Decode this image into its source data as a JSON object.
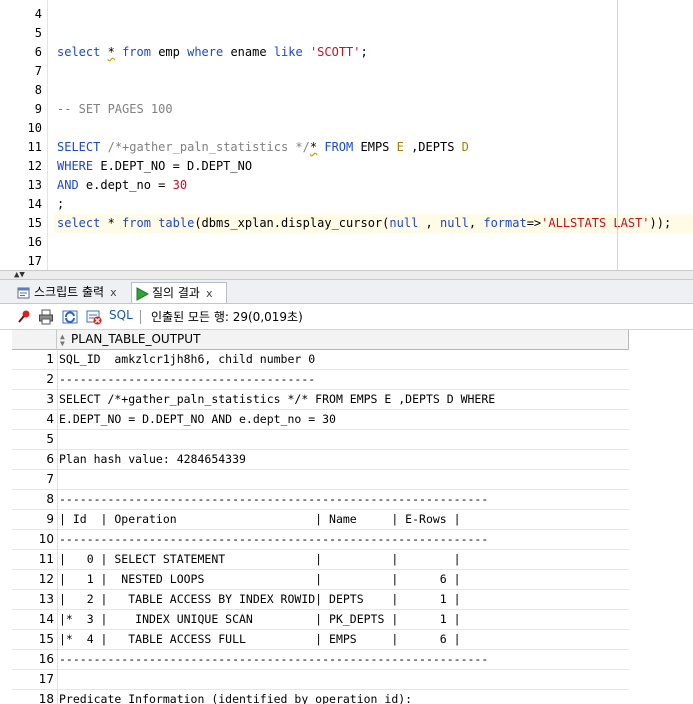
{
  "editor": {
    "lines": [
      {
        "n": "4",
        "tokens": []
      },
      {
        "n": "5",
        "tokens": []
      },
      {
        "n": "6",
        "tokens": [
          {
            "t": "select",
            "c": "kw"
          },
          {
            "t": " ",
            "c": "op"
          },
          {
            "t": "*",
            "c": "op",
            "warn": true
          },
          {
            "t": " ",
            "c": "op"
          },
          {
            "t": "from",
            "c": "kw"
          },
          {
            "t": " emp ",
            "c": "id"
          },
          {
            "t": "where",
            "c": "kw"
          },
          {
            "t": " ename ",
            "c": "id"
          },
          {
            "t": "like",
            "c": "kw"
          },
          {
            "t": " ",
            "c": "op"
          },
          {
            "t": "'SCOTT'",
            "c": "str"
          },
          {
            "t": ";",
            "c": "op"
          }
        ]
      },
      {
        "n": "7",
        "tokens": []
      },
      {
        "n": "8",
        "tokens": []
      },
      {
        "n": "9",
        "tokens": [
          {
            "t": "-- SET PAGES 100",
            "c": "cm"
          }
        ]
      },
      {
        "n": "10",
        "tokens": []
      },
      {
        "n": "11",
        "tokens": [
          {
            "t": "SELECT",
            "c": "kw"
          },
          {
            "t": " ",
            "c": "op"
          },
          {
            "t": "/*+gather_paln_statistics */",
            "c": "cm"
          },
          {
            "t": "*",
            "c": "op",
            "warn": true
          },
          {
            "t": " ",
            "c": "op"
          },
          {
            "t": "FROM",
            "c": "kw"
          },
          {
            "t": " EMPS ",
            "c": "id"
          },
          {
            "t": "E",
            "c": "tok-y"
          },
          {
            "t": " ,DEPTS ",
            "c": "id"
          },
          {
            "t": "D",
            "c": "tok-y"
          }
        ]
      },
      {
        "n": "12",
        "tokens": [
          {
            "t": "WHERE",
            "c": "kw"
          },
          {
            "t": " E.DEPT_NO = D.DEPT_NO",
            "c": "id"
          }
        ]
      },
      {
        "n": "13",
        "tokens": [
          {
            "t": "AND",
            "c": "kw"
          },
          {
            "t": " e.dept_no = ",
            "c": "id"
          },
          {
            "t": "30",
            "c": "str"
          }
        ]
      },
      {
        "n": "14",
        "tokens": [
          {
            "t": ";",
            "c": "op"
          }
        ]
      },
      {
        "n": "15",
        "tokens": [
          {
            "t": "select",
            "c": "kw"
          },
          {
            "t": " * ",
            "c": "op"
          },
          {
            "t": "from",
            "c": "kw"
          },
          {
            "t": " ",
            "c": "op"
          },
          {
            "t": "table",
            "c": "kw"
          },
          {
            "t": "(dbms_xplan.display_cursor(",
            "c": "id"
          },
          {
            "t": "null",
            "c": "kw"
          },
          {
            "t": " , ",
            "c": "op"
          },
          {
            "t": "null",
            "c": "kw"
          },
          {
            "t": ", ",
            "c": "op"
          },
          {
            "t": "format",
            "c": "kw"
          },
          {
            "t": "=>",
            "c": "op"
          },
          {
            "t": "'ALLSTATS LAST'",
            "c": "str"
          },
          {
            "t": "));",
            "c": "op"
          }
        ]
      },
      {
        "n": "16",
        "tokens": []
      },
      {
        "n": "17",
        "tokens": []
      }
    ]
  },
  "tabs": {
    "script_output": {
      "label": "스크립트 출력",
      "close": "x"
    },
    "query_result": {
      "label": "질의 결과",
      "close": "x"
    }
  },
  "toolbar": {
    "sql_label": "SQL",
    "separator": "|",
    "fetch_status": "인출된 모든 행: 29(0,019초)"
  },
  "grid": {
    "column": "PLAN_TABLE_OUTPUT",
    "rows": [
      {
        "n": "1",
        "v": "SQL_ID  amkzlcr1jh8h6, child number 0"
      },
      {
        "n": "2",
        "v": "-------------------------------------"
      },
      {
        "n": "3",
        "v": "SELECT /*+gather_paln_statistics */* FROM EMPS E ,DEPTS D WHERE"
      },
      {
        "n": "4",
        "v": "E.DEPT_NO = D.DEPT_NO AND e.dept_no = 30"
      },
      {
        "n": "5",
        "v": ""
      },
      {
        "n": "6",
        "v": "Plan hash value: 4284654339"
      },
      {
        "n": "7",
        "v": ""
      },
      {
        "n": "8",
        "v": "--------------------------------------------------------------"
      },
      {
        "n": "9",
        "v": "| Id  | Operation                    | Name     | E-Rows |"
      },
      {
        "n": "10",
        "v": "--------------------------------------------------------------"
      },
      {
        "n": "11",
        "v": "|   0 | SELECT STATEMENT             |          |        |"
      },
      {
        "n": "12",
        "v": "|   1 |  NESTED LOOPS                |          |      6 |"
      },
      {
        "n": "13",
        "v": "|   2 |   TABLE ACCESS BY INDEX ROWID| DEPTS    |      1 |"
      },
      {
        "n": "14",
        "v": "|*  3 |    INDEX UNIQUE SCAN         | PK_DEPTS |      1 |"
      },
      {
        "n": "15",
        "v": "|*  4 |   TABLE ACCESS FULL          | EMPS     |      6 |"
      },
      {
        "n": "16",
        "v": "--------------------------------------------------------------"
      },
      {
        "n": "17",
        "v": ""
      },
      {
        "n": "18",
        "v": "Predicate Information (identified by operation id):"
      }
    ]
  }
}
